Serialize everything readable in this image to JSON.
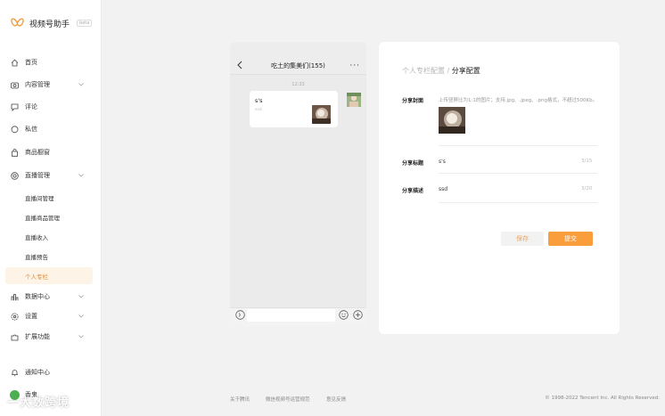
{
  "brand": {
    "name": "视频号助手",
    "badge": "beta",
    "logo_icon": "butterfly-logo-icon",
    "accent": "#e8892a"
  },
  "sidebar": {
    "items": [
      {
        "label": "首页",
        "icon": "home-icon",
        "chevron": false
      },
      {
        "label": "内容管理",
        "icon": "camera-icon",
        "chevron": true
      },
      {
        "label": "评论",
        "icon": "comment-icon",
        "chevron": false
      },
      {
        "label": "私信",
        "icon": "chat-bubble-icon",
        "chevron": false
      },
      {
        "label": "商品橱窗",
        "icon": "shopping-bag-icon",
        "chevron": false
      },
      {
        "label": "直播管理",
        "icon": "live-icon",
        "chevron": true
      }
    ],
    "live_sub": [
      "直播间管理",
      "直播商品管理",
      "直播收入",
      "直播预告",
      "个人专栏"
    ],
    "items2": [
      {
        "label": "数据中心",
        "icon": "bar-chart-icon",
        "chevron": true
      },
      {
        "label": "设置",
        "icon": "settings-gear-icon",
        "chevron": true
      },
      {
        "label": "扩展功能",
        "icon": "puzzle-icon",
        "chevron": true
      }
    ],
    "notify": {
      "label": "通知中心",
      "icon": "bell-icon"
    },
    "user": {
      "name": "香鬼"
    }
  },
  "phone": {
    "title": "吃土的集美们(155)",
    "time": "12:33",
    "bubble_title": "s's",
    "bubble_desc": "ssd",
    "icons": {
      "back": "chevron-left-icon",
      "more": "more-dots-icon",
      "voice": "voice-icon",
      "emoji": "emoji-icon",
      "plus": "plus-circle-icon"
    }
  },
  "panel": {
    "breadcrumb_parent": "个人专栏配置",
    "breadcrumb_sep": " / ",
    "breadcrumb_current": "分享配置",
    "cover_label": "分享封面",
    "cover_hint": "上传竖屏比为1:1的图片；支持.jpg、.jpeg、.png格式，不超过500Kb。",
    "title_label": "分享标题",
    "title_value": "s's",
    "title_counter": "3/15",
    "desc_label": "分享描述",
    "desc_value": "ssd",
    "desc_counter": "3/20",
    "save": "保存",
    "submit": "提交"
  },
  "footer": {
    "links": [
      "关于腾讯",
      "微信视频号运营规范",
      "意见反馈"
    ],
    "copyright": "© 1998-2022 Tencent Inc. All Rights Reserved."
  },
  "watermark": "一大数跨境"
}
